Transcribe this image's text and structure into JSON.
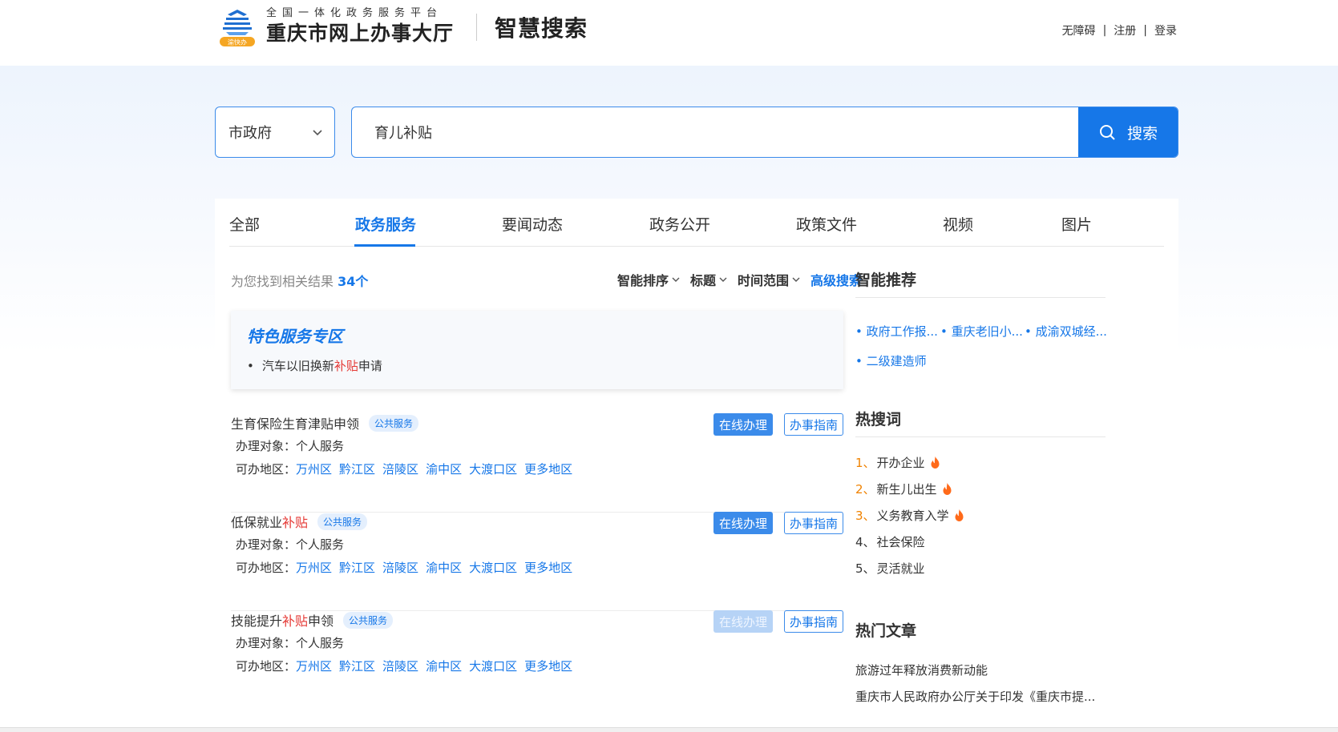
{
  "header": {
    "platform_subtitle": "全国一体化政务服务平台",
    "logo_badge": "渝快办",
    "site_name": "重庆市网上办事大厅",
    "section_title": "智慧搜索",
    "links": [
      "无障碍",
      "注册",
      "登录"
    ]
  },
  "search": {
    "scope": "市政府",
    "query": "育儿补贴",
    "button_label": "搜索"
  },
  "tabs": [
    {
      "label": "全部",
      "active": false
    },
    {
      "label": "政务服务",
      "active": true
    },
    {
      "label": "要闻动态",
      "active": false
    },
    {
      "label": "政务公开",
      "active": false
    },
    {
      "label": "政策文件",
      "active": false
    },
    {
      "label": "视频",
      "active": false
    },
    {
      "label": "图片",
      "active": false
    }
  ],
  "results_summary": {
    "prefix": "为您找到相关结果",
    "count": "34个"
  },
  "sorters": [
    "智能排序",
    "标题",
    "时间范围"
  ],
  "advanced_search": "高级搜索",
  "feature": {
    "title": "特色服务专区",
    "item_before": "汽车以旧换新",
    "item_highlight": "补贴",
    "item_after": "申请"
  },
  "results": [
    {
      "title_before": "生育保险生育津贴申领",
      "title_highlight": "",
      "title_after": "",
      "tag": "公共服务",
      "online_label": "在线办理",
      "online_enabled": true,
      "guide_label": "办事指南",
      "target_label": "办理对象：",
      "target_value": "个人服务",
      "regions_label": "可办地区：",
      "regions": [
        "万州区",
        "黔江区",
        "涪陵区",
        "渝中区",
        "大渡口区",
        "更多地区"
      ]
    },
    {
      "title_before": "低保就业",
      "title_highlight": "补贴",
      "title_after": "",
      "tag": "公共服务",
      "online_label": "在线办理",
      "online_enabled": true,
      "guide_label": "办事指南",
      "target_label": "办理对象：",
      "target_value": "个人服务",
      "regions_label": "可办地区：",
      "regions": [
        "万州区",
        "黔江区",
        "涪陵区",
        "渝中区",
        "大渡口区",
        "更多地区"
      ]
    },
    {
      "title_before": "技能提升",
      "title_highlight": "补贴",
      "title_after": "申领",
      "tag": "公共服务",
      "online_label": "在线办理",
      "online_enabled": false,
      "guide_label": "办事指南",
      "target_label": "办理对象：",
      "target_value": "个人服务",
      "regions_label": "可办地区：",
      "regions": [
        "万州区",
        "黔江区",
        "涪陵区",
        "渝中区",
        "大渡口区",
        "更多地区"
      ]
    }
  ],
  "sidebar": {
    "recommend_title": "智能推荐",
    "recommend": [
      "• 政府工作报...",
      "• 重庆老旧小...",
      "• 成渝双城经...",
      "• 二级建造师"
    ],
    "hot_title": "热搜词",
    "hot": [
      {
        "rank": "1、",
        "label": "开办企业",
        "fire": true
      },
      {
        "rank": "2、",
        "label": "新生儿出生",
        "fire": true
      },
      {
        "rank": "3、",
        "label": "义务教育入学",
        "fire": true
      },
      {
        "rank": "4、",
        "label": "社会保险",
        "fire": false
      },
      {
        "rank": "5、",
        "label": "灵活就业",
        "fire": false
      }
    ],
    "articles_title": "热门文章",
    "articles": [
      "旅游过年释放消费新动能",
      "重庆市人民政府办公厅关于印发《重庆市提..."
    ]
  },
  "colors": {
    "primary": "#1677e8",
    "highlight": "#e53935",
    "hot_rank": "#f08200",
    "fire": "#ff6a1a"
  }
}
